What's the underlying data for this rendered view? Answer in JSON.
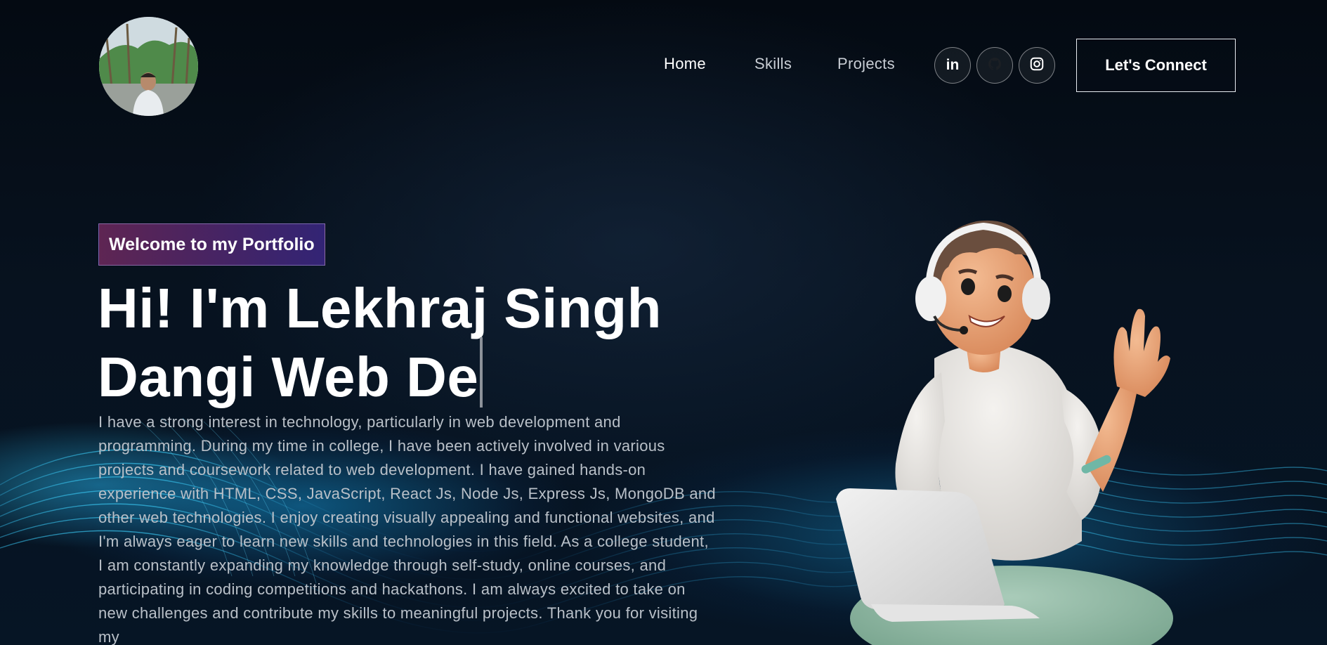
{
  "header": {
    "nav": [
      {
        "label": "Home",
        "active": true
      },
      {
        "label": "Skills",
        "active": false
      },
      {
        "label": "Projects",
        "active": false
      }
    ],
    "social": [
      {
        "name": "linkedin-icon",
        "glyph": "in"
      },
      {
        "name": "github-icon"
      },
      {
        "name": "instagram-icon"
      }
    ],
    "connect_label": "Let's Connect"
  },
  "hero": {
    "tagline": "Welcome to my Portfolio",
    "title_line1": "Hi! I'm Lekhraj Singh",
    "title_line2": "Dangi Web De",
    "bio": "I have a strong interest in technology, particularly in web development and programming. During my time in college, I have been actively involved in various projects and coursework related to web development. I have gained hands-on experience with HTML, CSS, JavaScript, React Js, Node Js, Express Js, MongoDB and other web technologies. I enjoy creating visually appealing and functional websites, and I'm always eager to learn new skills and technologies in this field. As a college student, I am constantly expanding my knowledge through self-study, online courses, and participating in coding competitions and hackathons. I am always excited to take on new challenges and contribute my skills to meaningful projects. Thank you for visiting my"
  },
  "colors": {
    "background": "#050c16",
    "tagline_gradient_start": "#aa367c",
    "tagline_gradient_end": "#4a2fbd",
    "text_primary": "#ffffff",
    "text_secondary": "#b9c0c8"
  }
}
